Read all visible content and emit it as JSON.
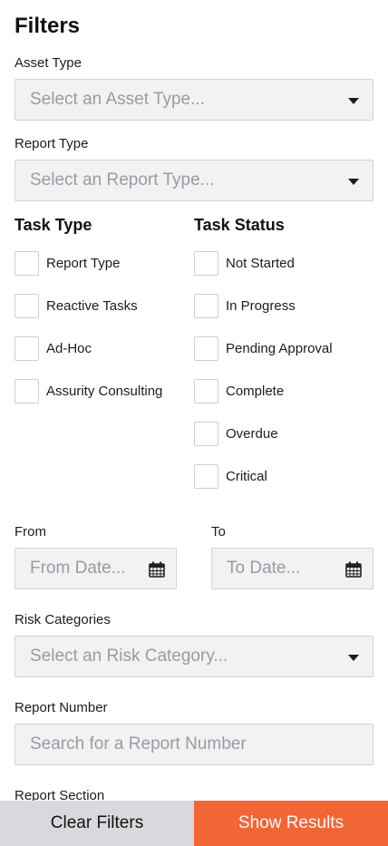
{
  "title": "Filters",
  "asset_type": {
    "label": "Asset Type",
    "placeholder": "Select an Asset Type..."
  },
  "report_type": {
    "label": "Report Type",
    "placeholder": "Select an Report Type..."
  },
  "task_type": {
    "heading": "Task Type",
    "options": [
      "Report Type",
      "Reactive Tasks",
      "Ad-Hoc",
      "Assurity Consulting"
    ]
  },
  "task_status": {
    "heading": "Task Status",
    "options": [
      "Not Started",
      "In Progress",
      "Pending Approval",
      "Complete",
      "Overdue",
      "Critical"
    ]
  },
  "dates": {
    "from_label": "From",
    "from_placeholder": "From Date...",
    "to_label": "To",
    "to_placeholder": "To Date..."
  },
  "risk_categories": {
    "label": "Risk Categories",
    "placeholder": "Select an Risk Category..."
  },
  "report_number": {
    "label": "Report Number",
    "placeholder": "Search for a Report Number"
  },
  "report_section": {
    "label": "Report Section"
  },
  "footer": {
    "clear_label": "Clear Filters",
    "show_label": "Show Results"
  },
  "colors": {
    "accent": "#f26535",
    "field_bg": "#f2f2f4",
    "clear_bg": "#d9d9dd"
  }
}
